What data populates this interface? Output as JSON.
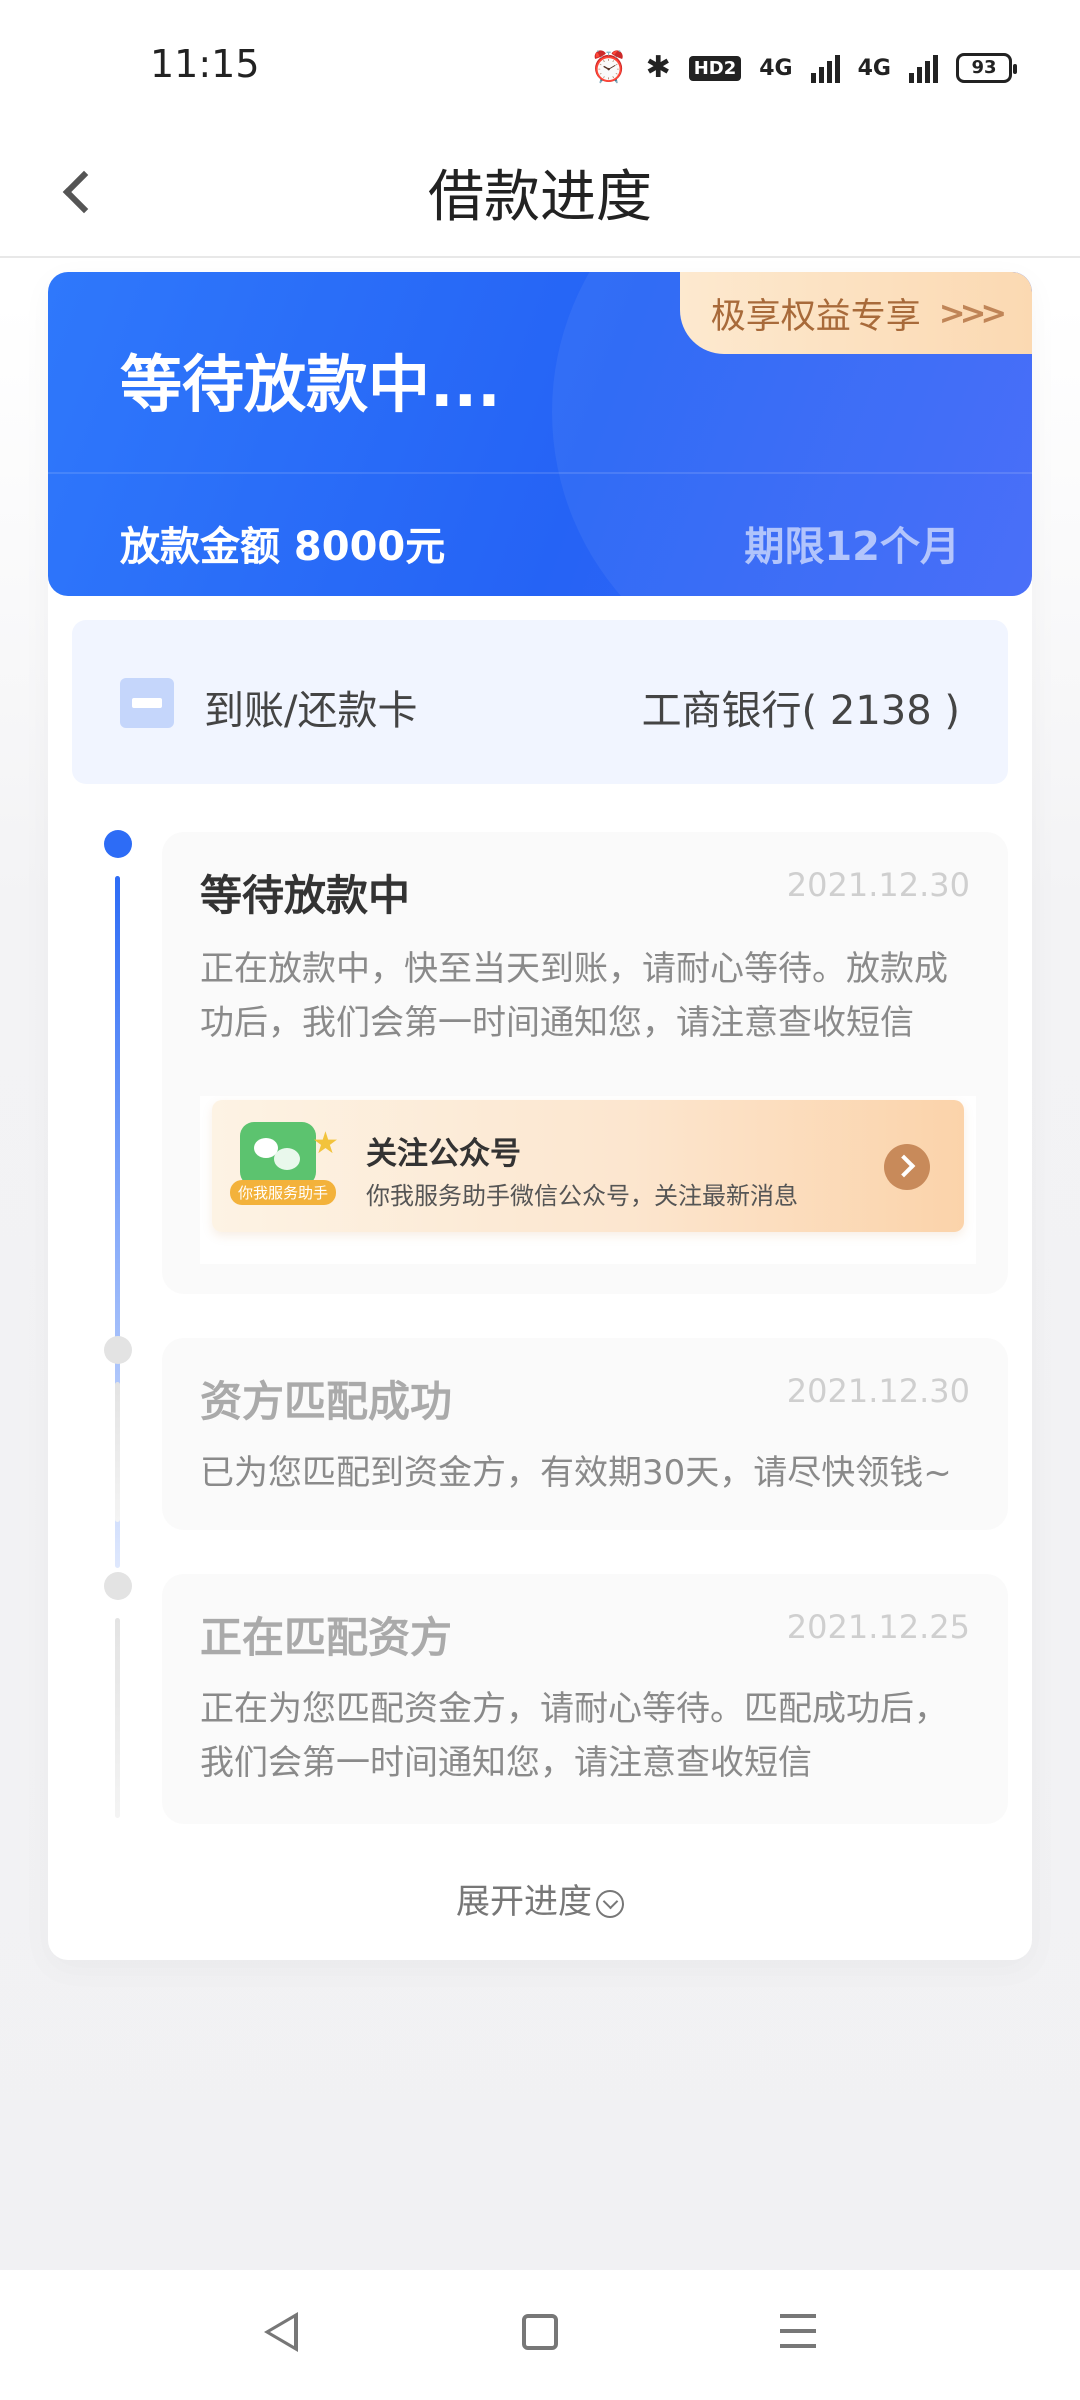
{
  "status_bar": {
    "time": "11:15",
    "hd_label": "HD2",
    "network_1": "4G",
    "network_2": "4G",
    "battery": "93",
    "icons": [
      "alarm-icon",
      "bluetooth-icon",
      "hd-voice-icon",
      "signal-icon",
      "signal-icon",
      "battery-icon"
    ]
  },
  "nav": {
    "title": "借款进度",
    "back_icon": "chevron-left-icon"
  },
  "hero": {
    "status": "等待放款中...",
    "amount_text": "放款金额 8000元",
    "term_text": "期限12个月",
    "benefit_label": "极享权益专享",
    "benefit_arrow": ">>>",
    "colors": {
      "primary": "#2563f5",
      "benefit_bg": "#fbd9b2",
      "benefit_text": "#a86a3a"
    }
  },
  "account": {
    "label": "到账/还款卡",
    "bank": "工商银行( 2138 )",
    "icon": "bank-card-icon"
  },
  "timeline": [
    {
      "title": "等待放款中",
      "date": "2021.12.30",
      "description": "正在放款中，快至当天到账，请耐心等待。放款成功后，我们会第一时间通知您，请注意查收短信",
      "active": true
    },
    {
      "title": "资方匹配成功",
      "date": "2021.12.30",
      "description": "已为您匹配到资金方，有效期30天，请尽快领钱~",
      "active": false
    },
    {
      "title": "正在匹配资方",
      "date": "2021.12.25",
      "description": "正在为您匹配资金方，请耐心等待。匹配成功后，我们会第一时间通知您，请注意查收短信",
      "active": false
    }
  ],
  "wechat_banner": {
    "tag": "你我服务助手",
    "title": "关注公众号",
    "subtitle": "你我服务助手微信公众号，关注最新消息",
    "icon": "wechat-icon"
  },
  "expand": {
    "label": "展开进度",
    "icon": "chevron-down-circle-icon"
  },
  "system_nav": {
    "icons": [
      "back-triangle-icon",
      "home-square-icon",
      "menu-lines-icon"
    ]
  }
}
